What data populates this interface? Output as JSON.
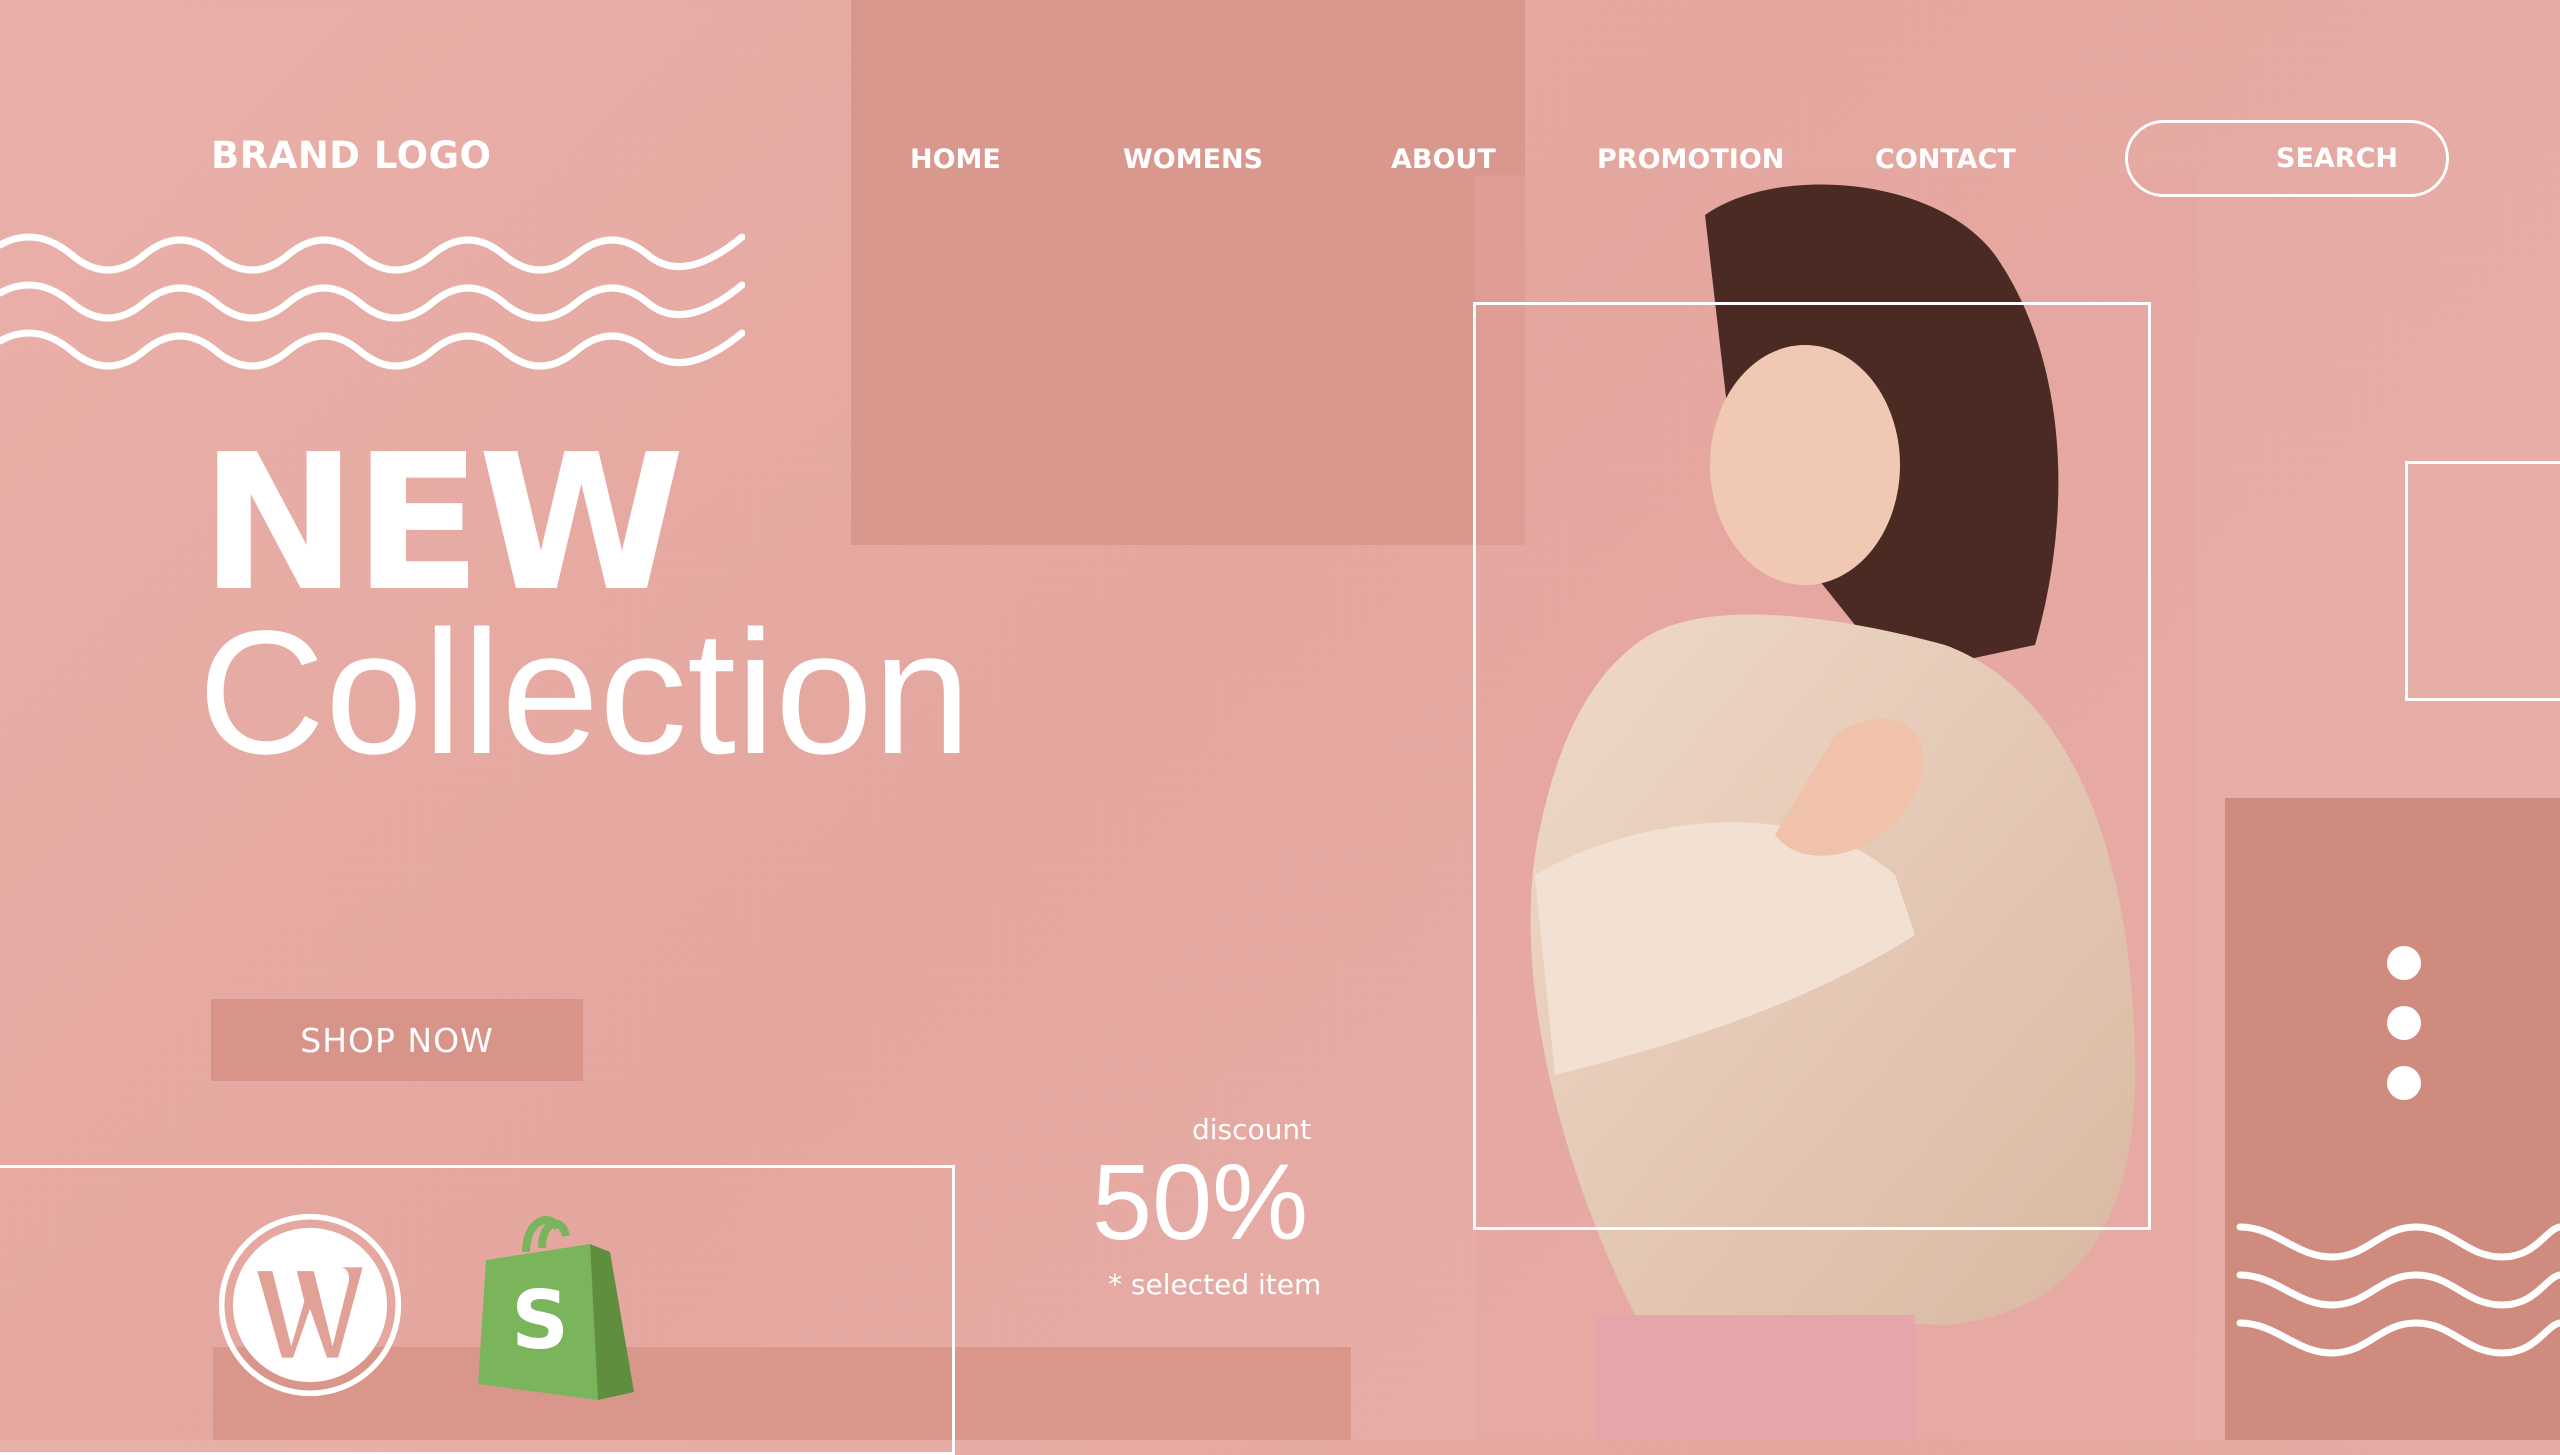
{
  "brand": {
    "logo_text": "BRAND LOGO"
  },
  "nav": {
    "items": [
      {
        "label": "HOME"
      },
      {
        "label": "WOMENS"
      },
      {
        "label": "ABOUT"
      },
      {
        "label": "PROMOTION"
      },
      {
        "label": "CONTACT"
      }
    ],
    "search_label": "SEARCH"
  },
  "hero": {
    "headline_bold": "NEW",
    "headline_light": "Collection",
    "cta_label": "SHOP NOW"
  },
  "promo": {
    "label": "discount",
    "value": "50%",
    "note": "* selected item"
  },
  "platforms": [
    {
      "name": "WordPress",
      "icon": "wordpress-logo-icon"
    },
    {
      "name": "Shopify",
      "icon": "shopify-bag-icon"
    }
  ],
  "colors": {
    "background": "#e6aca6",
    "accent_block": "#d9988e",
    "accent_dark": "#cf8c7e",
    "text": "#ffffff",
    "shopify_green": "#7ab55c",
    "shopify_dark": "#5e8e3e"
  }
}
